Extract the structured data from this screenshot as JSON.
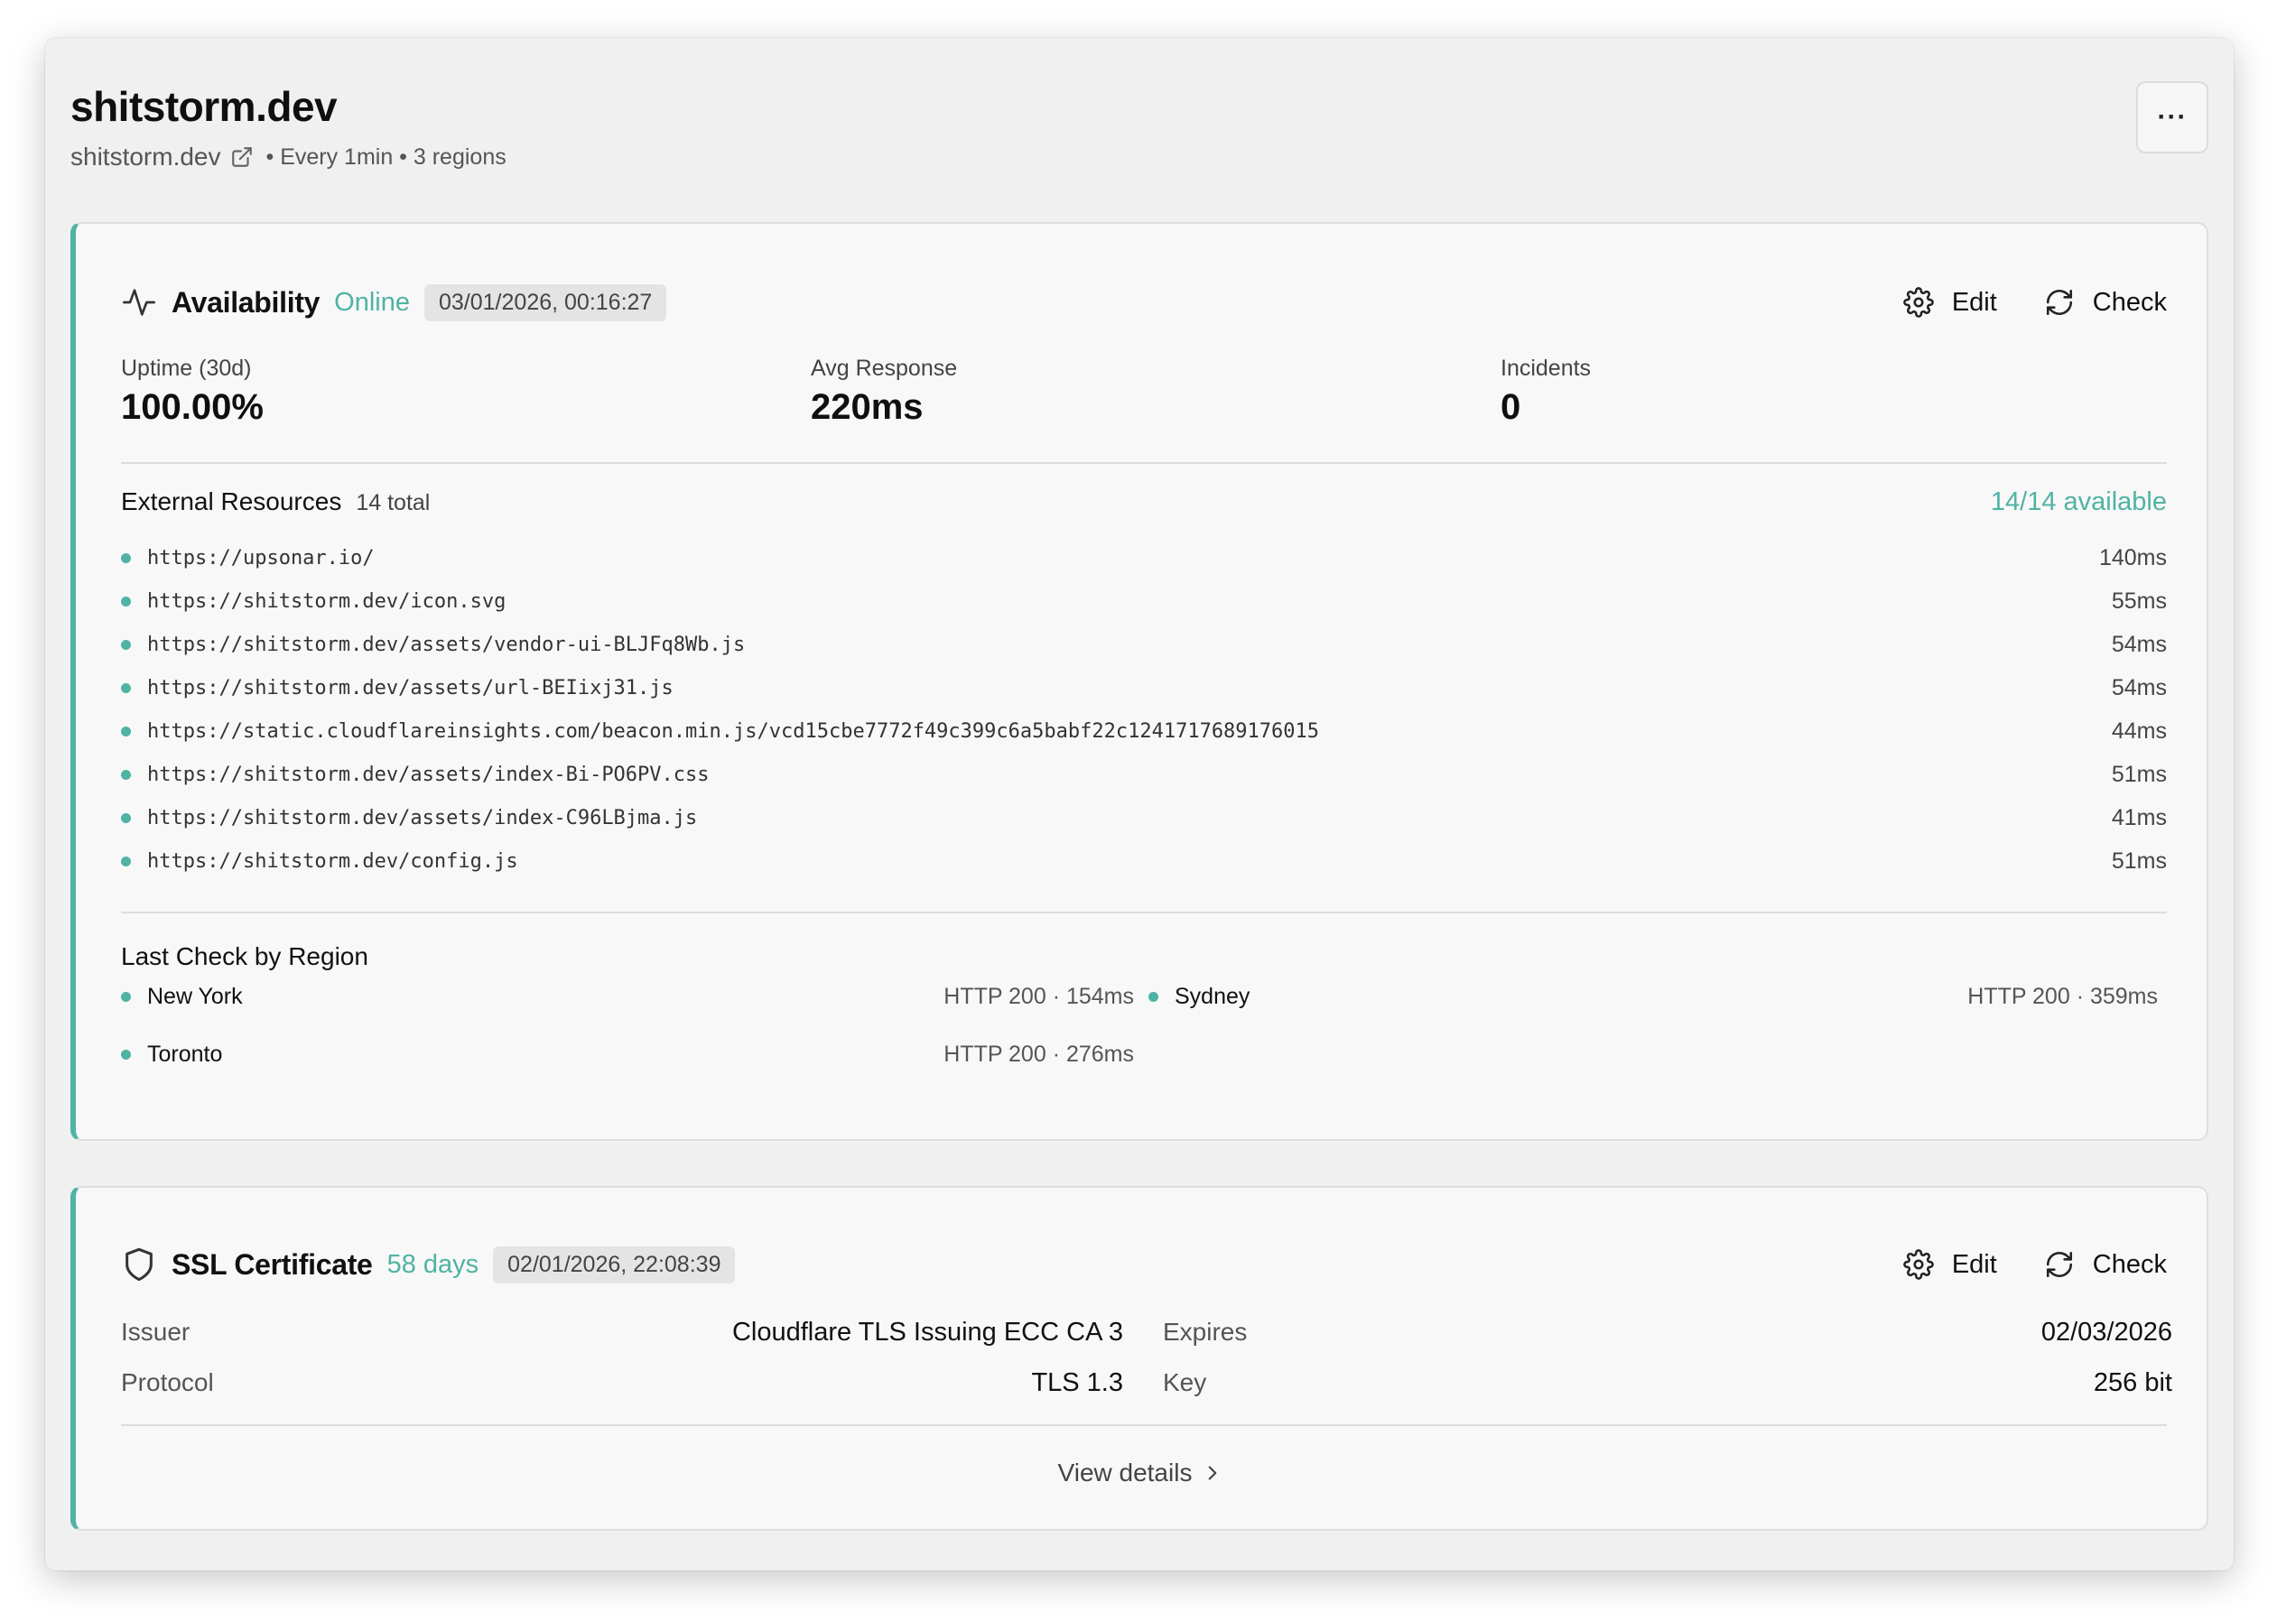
{
  "header": {
    "title": "shitstorm.dev",
    "domain": "shitstorm.dev",
    "meta": "• Every 1min • 3 regions",
    "more_label": "···"
  },
  "availability": {
    "title": "Availability",
    "status": "Online",
    "timestamp": "03/01/2026, 00:16:27",
    "edit_label": "Edit",
    "check_label": "Check",
    "stats": [
      {
        "label": "Uptime (30d)",
        "value": "100.00%"
      },
      {
        "label": "Avg Response",
        "value": "220ms"
      },
      {
        "label": "Incidents",
        "value": "0"
      }
    ],
    "resources": {
      "title": "External Resources",
      "count": "14 total",
      "available": "14/14 available",
      "items": [
        {
          "url": "https://upsonar.io/",
          "time": "140ms"
        },
        {
          "url": "https://shitstorm.dev/icon.svg",
          "time": "55ms"
        },
        {
          "url": "https://shitstorm.dev/assets/vendor-ui-BLJFq8Wb.js",
          "time": "54ms"
        },
        {
          "url": "https://shitstorm.dev/assets/url-BEIixj31.js",
          "time": "54ms"
        },
        {
          "url": "https://static.cloudflareinsights.com/beacon.min.js/vcd15cbe7772f49c399c6a5babf22c1241717689176015",
          "time": "44ms"
        },
        {
          "url": "https://shitstorm.dev/assets/index-Bi-PO6PV.css",
          "time": "51ms"
        },
        {
          "url": "https://shitstorm.dev/assets/index-C96LBjma.js",
          "time": "41ms"
        },
        {
          "url": "https://shitstorm.dev/config.js",
          "time": "51ms"
        }
      ]
    },
    "regions": {
      "title": "Last Check by Region",
      "items": [
        {
          "name": "New York",
          "status": "HTTP 200 · 154ms"
        },
        {
          "name": "Sydney",
          "status": "HTTP 200 · 359ms"
        },
        {
          "name": "Toronto",
          "status": "HTTP 200 · 276ms"
        }
      ]
    }
  },
  "ssl": {
    "title": "SSL Certificate",
    "status": "58 days",
    "timestamp": "02/01/2026, 22:08:39",
    "edit_label": "Edit",
    "check_label": "Check",
    "fields": {
      "issuer_label": "Issuer",
      "issuer_value": "Cloudflare TLS Issuing ECC CA 3",
      "expires_label": "Expires",
      "expires_value": "02/03/2026",
      "protocol_label": "Protocol",
      "protocol_value": "TLS 1.3",
      "key_label": "Key",
      "key_value": "256 bit"
    },
    "view_details_label": "View details"
  },
  "colors": {
    "accent": "#4fb3a3",
    "background": "#f0f0f0",
    "card": "#f8f8f8"
  },
  "icons": {
    "external_link": "external-link-icon",
    "activity": "activity-icon",
    "gear": "gear-icon",
    "refresh": "refresh-icon",
    "shield": "shield-icon",
    "chevron_right": "chevron-right-icon"
  }
}
